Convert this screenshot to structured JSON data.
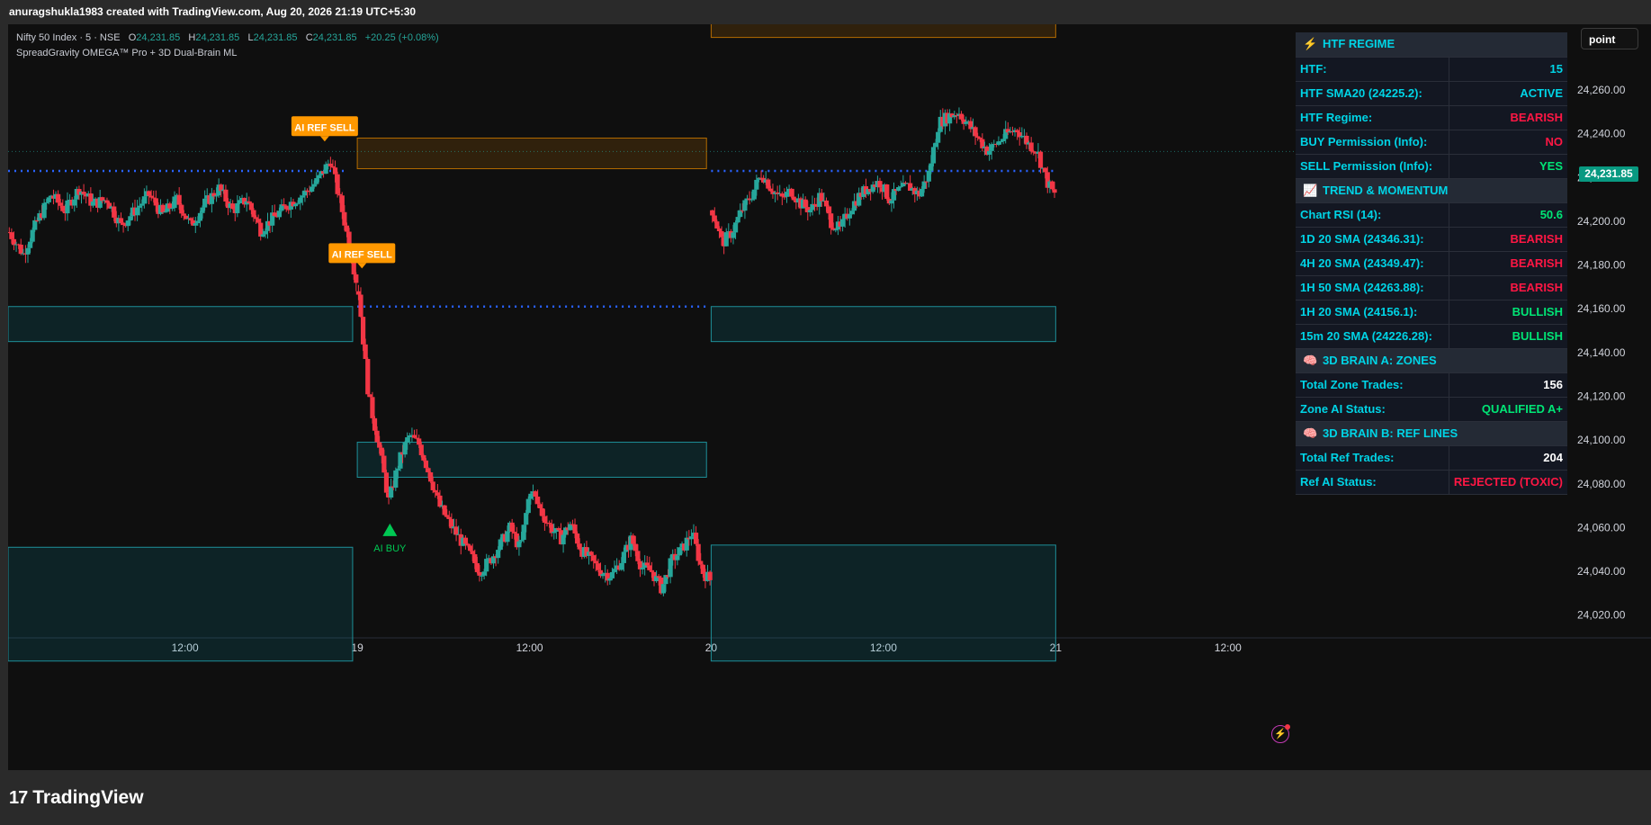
{
  "header": {
    "attribution": "anuragshukla1983 created with TradingView.com, Aug 20, 2026 21:19 UTC+5:30"
  },
  "legend": {
    "symbol": "Nifty 50 Index · 5 · NSE",
    "open_label": "O",
    "open": "24,231.85",
    "high_label": "H",
    "high": "24,231.85",
    "low_label": "L",
    "low": "24,231.85",
    "close_label": "C",
    "close": "24,231.85",
    "change": "+20.25 (+0.08%)",
    "indicator": "SpreadGravity OMEGA™ Pro + 3D Dual-Brain ML"
  },
  "toolbar": {
    "point_button": "point"
  },
  "last_price": "24,231.85",
  "panel": {
    "sections": [
      {
        "icon": "⚡",
        "icon_name": "bolt-icon",
        "title": "HTF REGIME",
        "rows": [
          {
            "label": "HTF:",
            "value": "15",
            "color": "cyan"
          },
          {
            "label": "HTF SMA20 (24225.2):",
            "value": "ACTIVE",
            "color": "cyan"
          },
          {
            "label": "HTF Regime:",
            "value": "BEARISH",
            "color": "bear"
          },
          {
            "label": "BUY Permission (Info):",
            "value": "NO",
            "color": "bear"
          },
          {
            "label": "SELL Permission (Info):",
            "value": "YES",
            "color": "bull"
          }
        ]
      },
      {
        "icon": "📈",
        "icon_name": "chart-trend-icon",
        "title": "TREND & MOMENTUM",
        "rows": [
          {
            "label": "Chart RSI (14):",
            "value": "50.6",
            "color": "bull"
          },
          {
            "label": "1D 20 SMA (24346.31):",
            "value": "BEARISH",
            "color": "bear"
          },
          {
            "label": "4H 20 SMA (24349.47):",
            "value": "BEARISH",
            "color": "bear"
          },
          {
            "label": "1H 50 SMA (24263.88):",
            "value": "BEARISH",
            "color": "bear"
          },
          {
            "label": "1H 20 SMA (24156.1):",
            "value": "BULLISH",
            "color": "bull"
          },
          {
            "label": "15m 20 SMA (24226.28):",
            "value": "BULLISH",
            "color": "bull"
          }
        ]
      },
      {
        "icon": "🧠",
        "icon_name": "brain-icon",
        "title": "3D BRAIN A: ZONES",
        "rows": [
          {
            "label": "Total Zone Trades:",
            "value": "156",
            "color": "white"
          },
          {
            "label": "Zone AI Status:",
            "value": "QUALIFIED A+",
            "color": "bull"
          }
        ]
      },
      {
        "icon": "🧠",
        "icon_name": "brain-icon",
        "title": "3D BRAIN B: REF LINES",
        "rows": [
          {
            "label": "Total Ref Trades:",
            "value": "204",
            "color": "white"
          },
          {
            "label": "Ref AI Status:",
            "value": "REJECTED (TOXIC)",
            "color": "bear"
          }
        ]
      }
    ]
  },
  "colors": {
    "up": "#26a69a",
    "down": "#f23645",
    "bull": "#00e676",
    "bear": "#ff1744",
    "cyan": "#00d4e6",
    "white": "#ffffff",
    "orange": "#ff9800",
    "dotted_line": "#2962ff",
    "zone_teal": "#1e8f99"
  },
  "brand": {
    "logo": "17",
    "name": "TradingView"
  },
  "chart_data": {
    "type": "candlestick",
    "y_ticks": [
      24260,
      24240,
      24220,
      24200,
      24180,
      24160,
      24140,
      24120,
      24100,
      24080,
      24060,
      24040,
      24020
    ],
    "y_tick_labels": [
      "24,260.00",
      "24,240.00",
      "24,220.00",
      "24,200.00",
      "24,180.00",
      "24,160.00",
      "24,140.00",
      "24,120.00",
      "24,100.00",
      "24,080.00",
      "24,060.00",
      "24,040.00",
      "24,020.00"
    ],
    "ylim": [
      24010,
      24290
    ],
    "x_tick_labels": [
      "12:00",
      "19",
      "12:00",
      "20",
      "12:00",
      "21",
      "12:00"
    ],
    "x_ticks": [
      9.5,
      18.75,
      28.0,
      37.75,
      47.0,
      56.25,
      65.5
    ],
    "xlim": [
      0,
      71.5
    ],
    "sessions": [
      {
        "start": 0.0,
        "end": 18.75,
        "open": 24195,
        "path": [
          24195,
          24185,
          24200,
          24212,
          24205,
          24215,
          24208,
          24210,
          24198,
          24205,
          24212,
          24203,
          24210,
          24198,
          24208,
          24215,
          24205,
          24210,
          24196,
          24202,
          24208,
          24212,
          24218,
          24228,
          24200,
          24168
        ]
      },
      {
        "start": 18.75,
        "end": 37.75,
        "open": 24168,
        "path": [
          24168,
          24120,
          24098,
          24072,
          24090,
          24102,
          24098,
          24085,
          24070,
          24062,
          24055,
          24048,
          24040,
          24045,
          24052,
          24060,
          24050,
          24078,
          24068,
          24060,
          24055,
          24062,
          24050,
          24045,
          24040,
          24038,
          24045,
          24055,
          24042,
          24040,
          24032,
          24045,
          24050,
          24058,
          24040,
          24035
        ]
      },
      {
        "start": 37.75,
        "end": 56.25,
        "open": 24205,
        "path": [
          24205,
          24190,
          24195,
          24205,
          24212,
          24222,
          24215,
          24210,
          24214,
          24208,
          24205,
          24212,
          24200,
          24196,
          24206,
          24212,
          24216,
          24218,
          24210,
          24214,
          24216,
          24212,
          24222,
          24245,
          24248,
          24250,
          24244,
          24238,
          24232,
          24236,
          24240,
          24242,
          24236,
          24232,
          24218,
          24210
        ]
      }
    ],
    "dotted_levels": [
      {
        "price": 24223,
        "x_start": 0.0,
        "x_end": 18.2
      },
      {
        "price": 24223,
        "x_start": 37.75,
        "x_end": 56.25
      },
      {
        "price": 24161,
        "x_start": 18.75,
        "x_end": 37.5
      }
    ],
    "zones": [
      {
        "kind": "supply",
        "x_start": 18.75,
        "x_end": 37.5,
        "top": 24238,
        "bottom": 24224
      },
      {
        "kind": "supply",
        "x_start": 37.75,
        "x_end": 56.25,
        "top": 24299,
        "bottom": 24284
      },
      {
        "kind": "demand",
        "x_start": 0.0,
        "x_end": 18.5,
        "top": 24161,
        "bottom": 24145
      },
      {
        "kind": "demand",
        "x_start": 37.75,
        "x_end": 56.25,
        "top": 24161,
        "bottom": 24145
      },
      {
        "kind": "demand",
        "x_start": 18.75,
        "x_end": 37.5,
        "top": 24099,
        "bottom": 24083
      },
      {
        "kind": "demand",
        "x_start": 0.0,
        "x_end": 18.5,
        "top": 24051,
        "bottom": 23999
      },
      {
        "kind": "demand",
        "x_start": 37.75,
        "x_end": 56.25,
        "top": 24052,
        "bottom": 23999
      }
    ],
    "signals": [
      {
        "label": "AI REF SELL",
        "type": "sell",
        "x": 17.0,
        "price": 24243
      },
      {
        "label": "AI REF SELL",
        "type": "sell",
        "x": 19.0,
        "price": 24185
      },
      {
        "label": "AI BUY",
        "type": "buy",
        "x": 20.5,
        "price": 24059
      }
    ]
  }
}
